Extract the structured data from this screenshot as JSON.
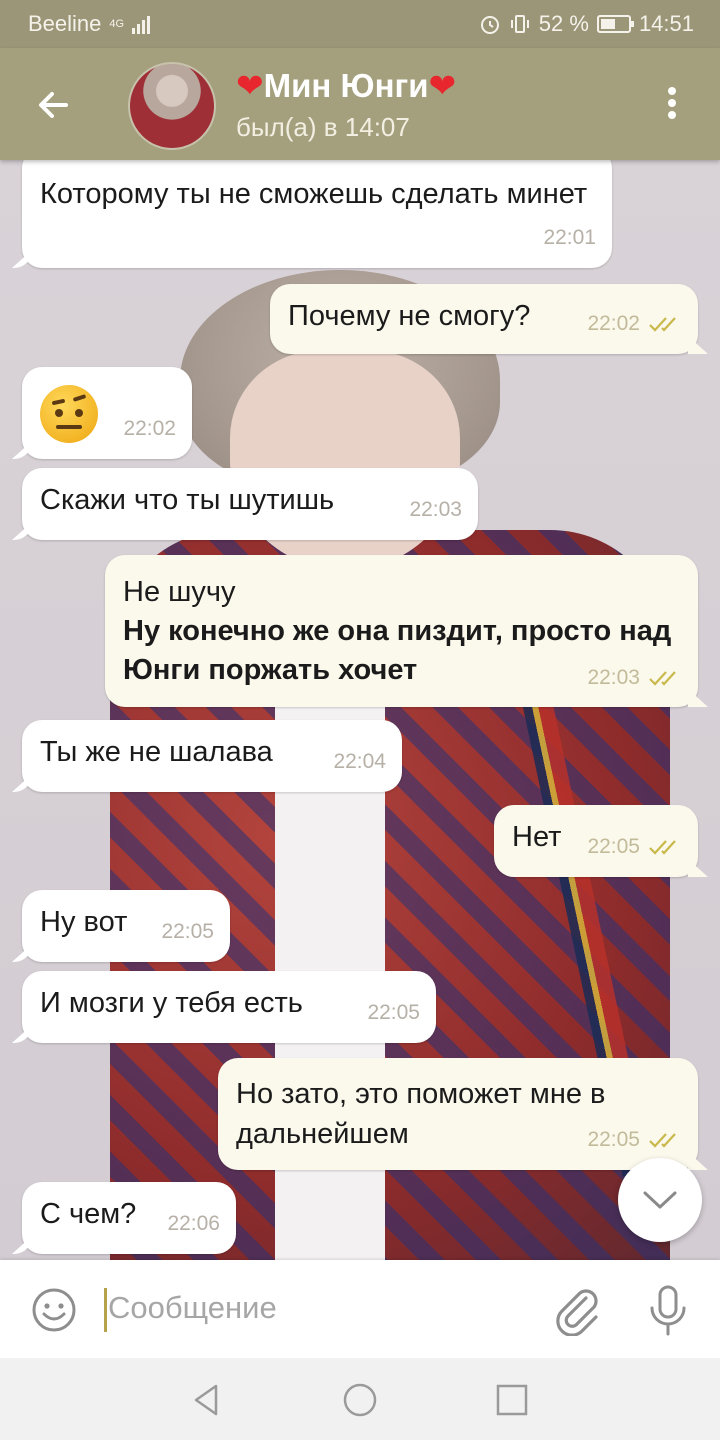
{
  "status_bar": {
    "carrier": "Beeline",
    "network": "4G",
    "battery": "52 %",
    "battery_level": 0.52,
    "time": "14:51"
  },
  "header": {
    "heart_left": "❤",
    "contact_name": "Мин Юнги",
    "heart_right": "❤",
    "last_seen": "был(а) в 14:07",
    "icons": {
      "back": "back-arrow-icon",
      "menu": "more-vertical-icon"
    }
  },
  "messages": [
    {
      "direction": "in",
      "text": "Которому ты не сможешь сделать минет",
      "time": "22:01"
    },
    {
      "direction": "out",
      "text": "Почему не смогу?",
      "time": "22:02",
      "read": true
    },
    {
      "direction": "in",
      "emoji": "face-with-raised-eyebrow",
      "time": "22:02"
    },
    {
      "direction": "in",
      "text": "Скажи что ты шутишь",
      "time": "22:03"
    },
    {
      "direction": "out",
      "text": "Не шучу",
      "text_bold": "Ну конечно же она пиздит, просто над Юнги поржать хочет",
      "time": "22:03",
      "read": true
    },
    {
      "direction": "in",
      "text": "Ты же не шалава",
      "time": "22:04"
    },
    {
      "direction": "out",
      "text": "Нет",
      "time": "22:05",
      "read": true
    },
    {
      "direction": "in",
      "text": "Ну вот",
      "time": "22:05"
    },
    {
      "direction": "in",
      "text": "И мозги у тебя есть",
      "time": "22:05"
    },
    {
      "direction": "out",
      "text": "Но зато, это поможет мне в дальнейшем",
      "time": "22:05",
      "read": true
    },
    {
      "direction": "in",
      "text": "С чем?",
      "time": "22:06"
    }
  ],
  "composer": {
    "placeholder": "Сообщение",
    "icons": {
      "emoji": "smiley-icon",
      "attach": "paperclip-icon",
      "mic": "microphone-icon"
    }
  },
  "colors": {
    "header": "#a4a07d",
    "status_bar": "#9b9678",
    "incoming_bubble": "#ffffff",
    "outgoing_bubble": "#fbf8ec",
    "read_check": "#c9b84a"
  }
}
